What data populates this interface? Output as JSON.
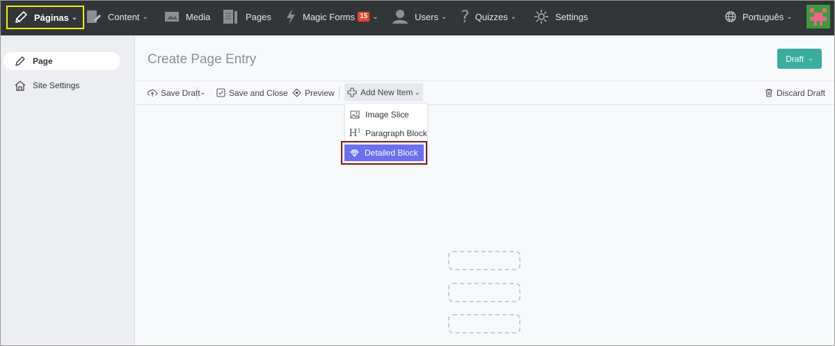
{
  "topbar": {
    "paginas_label": "Páginas",
    "content_label": "Content",
    "media_label": "Media",
    "pages_label": "Pages",
    "magic_forms_label": "Magic Forms",
    "magic_forms_badge": "15",
    "users_label": "Users",
    "quizzes_label": "Quizzes",
    "settings_label": "Settings",
    "language_label": "Português"
  },
  "sidebar": {
    "items": [
      {
        "label": "Page",
        "icon": "pencil-icon",
        "active": true
      },
      {
        "label": "Site Settings",
        "icon": "home-icon",
        "active": false
      }
    ]
  },
  "main": {
    "title": "Create Page Entry",
    "status_button": "Draft"
  },
  "toolbar": {
    "save_draft": "Save Draft",
    "save_and_close": "Save and Close",
    "preview": "Preview",
    "add_new_item": "Add New Item",
    "discard_draft": "Discard Draft"
  },
  "dropdown": {
    "items": [
      {
        "label": "Image Slice",
        "icon": "image-icon"
      },
      {
        "label": "Paragraph Block",
        "icon": "heading-icon"
      },
      {
        "label": "Detailed Block",
        "icon": "diamond-icon",
        "selected": true
      }
    ]
  },
  "colors": {
    "topbar_bg": "#333638",
    "accent_teal": "#3aae9d",
    "selected_purple": "#6b6ff2",
    "highlight_yellow": "#f5f000",
    "highlight_red": "#7b1416",
    "badge_red": "#e8462a"
  }
}
